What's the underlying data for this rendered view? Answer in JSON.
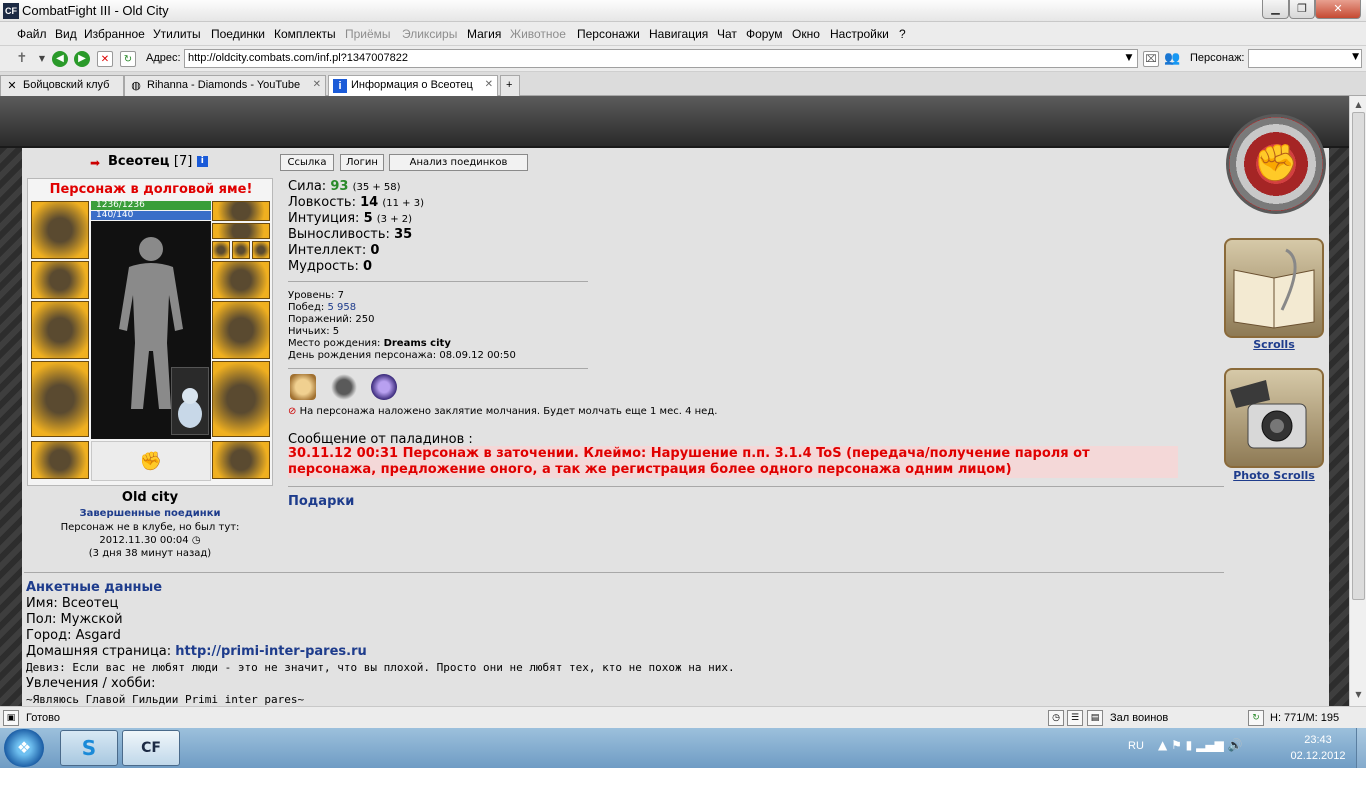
{
  "window": {
    "title": "CombatFight III - Old City",
    "app_icon": "CF"
  },
  "menu": [
    "Файл",
    "Вид",
    "Избранное",
    "Утилиты",
    "Поединки",
    "Комплекты",
    "Приёмы",
    "Эликсиры",
    "Магия",
    "Животное",
    "Персонажи",
    "Навигация",
    "Чат",
    "Форум",
    "Окно",
    "Настройки",
    "?"
  ],
  "menu_disabled": [
    "Приёмы",
    "Эликсиры",
    "Животное"
  ],
  "address": {
    "label": "Адрес:",
    "url": "http://oldcity.combats.com/inf.pl?1347007822",
    "character_label": "Персонаж:"
  },
  "tabs": [
    {
      "label": "Бойцовский клуб",
      "icon": "crossed-swords-icon",
      "active": false
    },
    {
      "label": "Rihanna - Diamonds - YouTube",
      "icon": "globe-icon",
      "active": false
    },
    {
      "label": "Информация о Всеотец",
      "icon": "info-icon",
      "active": true
    }
  ],
  "character": {
    "name": "Всеотец",
    "level": "[7]",
    "debt_title": "Персонаж в долговой яме!",
    "hp": "1236/1236",
    "mp": "140/140",
    "city": "Old city",
    "fights_link": "Завершенные поединки",
    "not_in_club": "Персонаж не в клубе, но был тут:",
    "last_seen": "2012.11.30 00:04",
    "ago": "(3 дня 38 минут назад)"
  },
  "buttons": {
    "link": "Ссылка",
    "login": "Логин",
    "analysis": "Анализ поединков"
  },
  "stats": [
    {
      "label": "Сила:",
      "value": "93",
      "extra": "(35 + 58)",
      "highlight": true
    },
    {
      "label": "Ловкость:",
      "value": "14",
      "extra": "(11 + 3)",
      "highlight": false
    },
    {
      "label": "Интуиция:",
      "value": "5",
      "extra": "(3 + 2)",
      "highlight": false
    },
    {
      "label": "Выносливость:",
      "value": "35",
      "extra": "",
      "highlight": false
    },
    {
      "label": "Интеллект:",
      "value": "0",
      "extra": "",
      "highlight": false
    },
    {
      "label": "Мудрость:",
      "value": "0",
      "extra": "",
      "highlight": false
    }
  ],
  "info": {
    "level": "Уровень: 7",
    "wins_label": "Побед:",
    "wins_value": "5 958",
    "losses": "Поражений: 250",
    "draws": "Ничьих: 5",
    "birthplace_label": "Место рождения:",
    "birthplace_value": "Dreams city",
    "birthday": "День рождения персонажа: 08.09.12 00:50"
  },
  "silence_text": "На персонажа наложено заклятие молчания. Будет молчать еще 1 мес. 4 нед.",
  "paladin": {
    "title": "Сообщение от паладинов :",
    "message": "30.11.12 00:31 Персонаж в заточении. Клеймо: Нарушение п.п. 3.1.4 ToS (передача/получение пароля от персонажа, предложение оного, а так же регистрация более одного персонажа одним лицом)"
  },
  "gifts": "Подарки",
  "profile": {
    "title": "Анкетные данные",
    "name": "Имя: Всеотец",
    "gender": "Пол: Мужской",
    "city": "Город: Asgard",
    "homepage_label": "Домашняя страница:",
    "homepage_url": "http://primi-inter-pares.ru",
    "motto": "Девиз: Если вас не любят люди - это не значит, что вы плохой. Просто они не любят тех, кто не похож на них.",
    "hobbies_label": "Увлечения / хобби:",
    "hobbies_value": "~Являюсь Главой Гильдии Primi inter pares~"
  },
  "side": {
    "scrolls": "Scrolls",
    "photo_scrolls": "Photo Scrolls"
  },
  "status": {
    "text": "Готово",
    "hall": "Зал воинов",
    "hm": "H: 771/M: 195"
  },
  "taskbar": {
    "lang": "RU",
    "time": "23:43",
    "date": "02.12.2012"
  },
  "colors": {
    "debt_red": "#e00000",
    "link_blue": "#1e3c8c",
    "hp_green": "#3a9e3a",
    "mp_blue": "#3a6ec8"
  }
}
